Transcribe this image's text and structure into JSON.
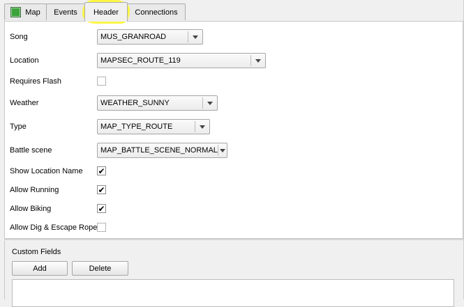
{
  "tabs": [
    {
      "label": "Map",
      "icon": "map-icon"
    },
    {
      "label": "Events"
    },
    {
      "label": "Header",
      "active": true
    },
    {
      "label": "Connections"
    }
  ],
  "header": {
    "song": {
      "label": "Song",
      "value": "MUS_GRANROAD"
    },
    "location": {
      "label": "Location",
      "value": "MAPSEC_ROUTE_119"
    },
    "requires_flash": {
      "label": "Requires Flash",
      "checked": false
    },
    "weather": {
      "label": "Weather",
      "value": "WEATHER_SUNNY"
    },
    "type": {
      "label": "Type",
      "value": "MAP_TYPE_ROUTE"
    },
    "battle_scene": {
      "label": "Battle scene",
      "value": "MAP_BATTLE_SCENE_NORMAL"
    },
    "show_location_name": {
      "label": "Show Location Name",
      "checked": true
    },
    "allow_running": {
      "label": "Allow Running",
      "checked": true
    },
    "allow_biking": {
      "label": "Allow Biking",
      "checked": true
    },
    "allow_dig_escape": {
      "label": "Allow Dig & Escape Rope",
      "checked": false
    }
  },
  "custom_fields": {
    "title": "Custom Fields",
    "add_label": "Add",
    "delete_label": "Delete"
  },
  "check_glyph": "✔",
  "colors": {
    "highlight": "#fdf53b",
    "map_icon": "#3aa33a"
  }
}
